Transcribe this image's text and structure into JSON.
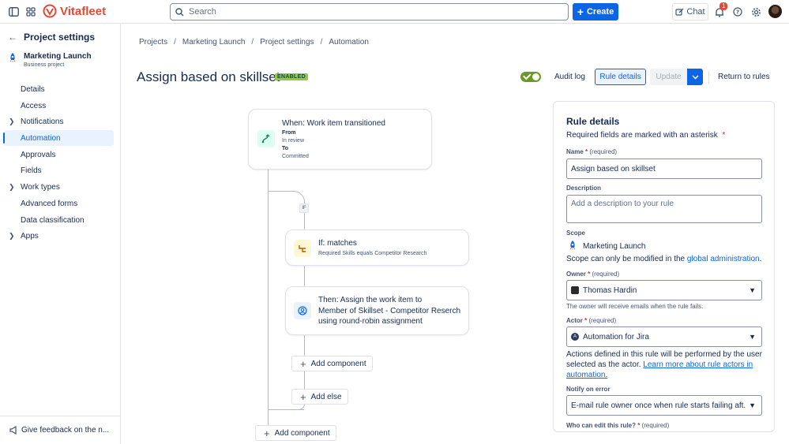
{
  "app": {
    "name": "Vitafleet"
  },
  "topbar": {
    "search_placeholder": "Search",
    "create_label": "Create",
    "chat_label": "Chat",
    "notification_count": "1"
  },
  "sidebar": {
    "header": "Project settings",
    "project_name": "Marketing Launch",
    "project_type": "Business project",
    "items": [
      {
        "label": "Details"
      },
      {
        "label": "Access"
      },
      {
        "label": "Notifications"
      },
      {
        "label": "Automation"
      },
      {
        "label": "Approvals"
      },
      {
        "label": "Fields"
      },
      {
        "label": "Work types"
      },
      {
        "label": "Advanced forms"
      },
      {
        "label": "Data classification"
      },
      {
        "label": "Apps"
      }
    ],
    "feedback_label": "Give feedback on the n..."
  },
  "breadcrumb": [
    "Projects",
    "Marketing Launch",
    "Project settings",
    "Automation"
  ],
  "header": {
    "title": "Assign based on skillset",
    "status_badge": "ENABLED",
    "enabled": true,
    "audit_log": "Audit log",
    "rule_details": "Rule details",
    "update": "Update",
    "return_to_rules": "Return to rules"
  },
  "flow": {
    "trigger": {
      "title": "When: Work item transitioned",
      "from_label": "From",
      "from_value": "In review",
      "to_label": "To",
      "to_value": "Committed"
    },
    "if_tag": "IF",
    "condition": {
      "title": "If: matches",
      "subtitle": "Required Skills equals Competitor Research"
    },
    "action": {
      "line1": "Then: Assign the work item to",
      "line2": "Member of Skillset - Competitor Reserch",
      "line3": "using round-robin assignment"
    },
    "add_component_inner": "Add component",
    "add_else": "Add else",
    "add_component_outer": "Add component"
  },
  "panel": {
    "title": "Rule details",
    "required_note": "Required fields are marked with an asterisk",
    "name_label": "Name",
    "name_value": "Assign based on skillset",
    "required_text": "(required)",
    "description_label": "Description",
    "description_placeholder": "Add a description to your rule",
    "scope_label": "Scope",
    "scope_value": "Marketing Launch",
    "scope_note_prefix": "Scope can only be modified in the ",
    "scope_note_link": "global administration",
    "scope_note_suffix": ".",
    "owner_label": "Owner",
    "owner_value": "Thomas Hardin",
    "owner_help": "The owner will receive emails when the rule fails.",
    "actor_label": "Actor",
    "actor_value": "Automation for Jira",
    "actor_help_prefix": "Actions defined in this rule will be performed by the user selected as the actor. ",
    "actor_help_link": "Learn more about rule actors in automation.",
    "notify_label": "Notify on error",
    "notify_value": "E-mail rule owner once when rule starts failing aft...",
    "edit_label": "Who can edit this rule?"
  },
  "colors": {
    "accent": "#0c66e4",
    "brand": "#e34935",
    "enabled": "#94c748",
    "toggle_on": "#6a9a23"
  }
}
